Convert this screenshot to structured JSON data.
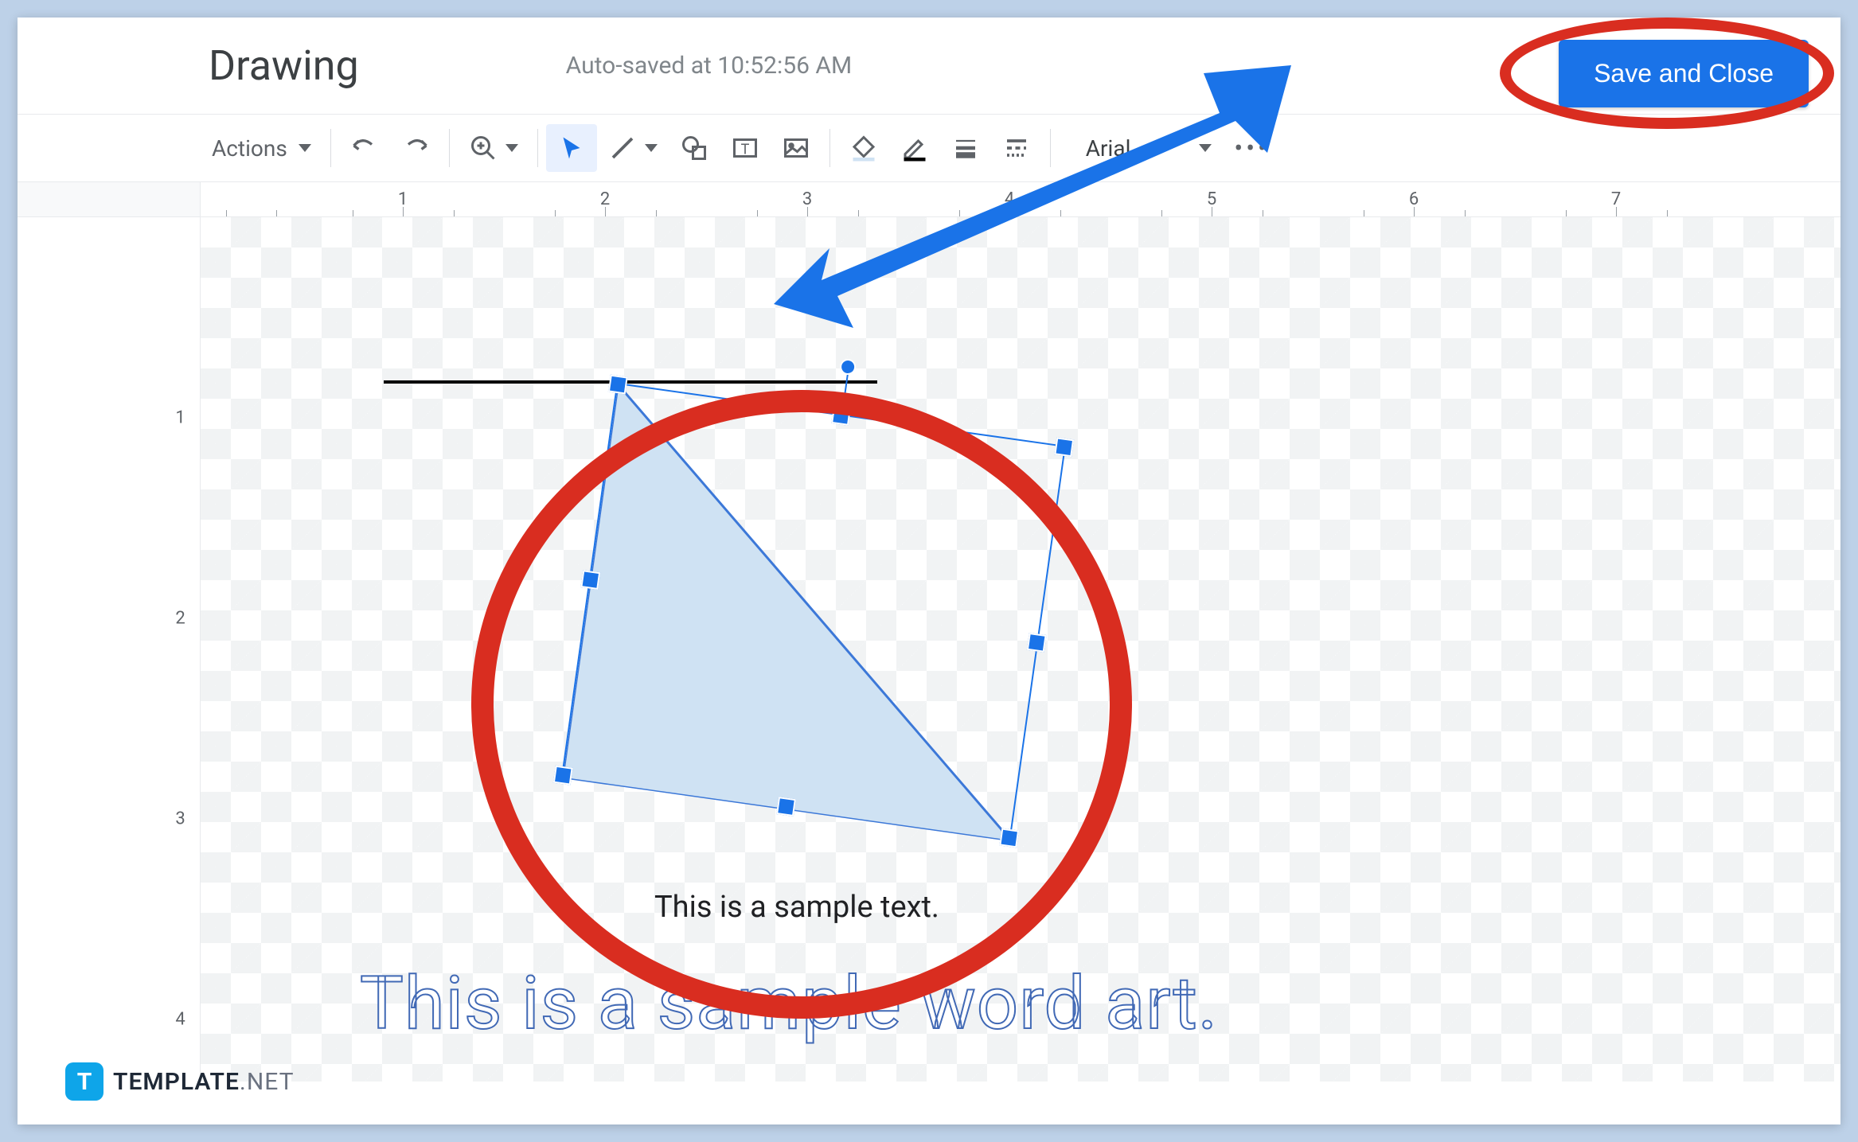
{
  "header": {
    "title": "Drawing",
    "autosave": "Auto-saved at 10:52:56 AM",
    "save_button": "Save and Close"
  },
  "toolbar": {
    "actions_label": "Actions",
    "font_name": "Arial"
  },
  "ruler": {
    "h_numbers": [
      "1",
      "2",
      "3",
      "4",
      "5",
      "6",
      "7"
    ],
    "v_numbers": [
      "1",
      "2",
      "3",
      "4"
    ]
  },
  "canvas": {
    "sample_text": "This is a sample text.",
    "word_art": "This is a sample word art."
  },
  "watermark": {
    "icon_letter": "T",
    "brand": "TEMPLATE",
    "tld": ".NET"
  }
}
